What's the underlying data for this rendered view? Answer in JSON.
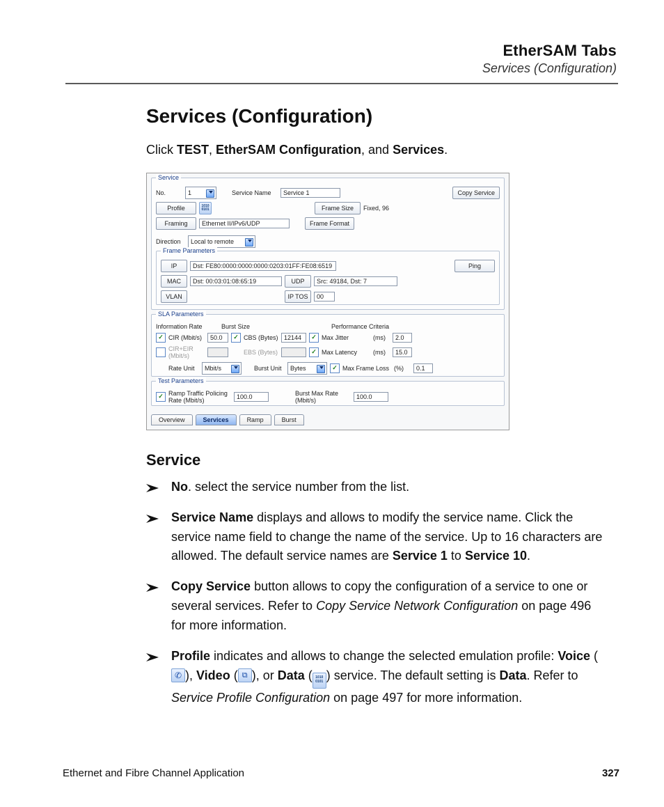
{
  "header": {
    "title": "EtherSAM Tabs",
    "subtitle": "Services (Configuration)"
  },
  "title": "Services (Configuration)",
  "intro": {
    "prefix": "Click ",
    "b1": "TEST",
    "mid1": ", ",
    "b2": "EtherSAM Configuration",
    "mid2": ", and ",
    "b3": "Services",
    "suffix": "."
  },
  "screenshot": {
    "service": {
      "legend": "Service",
      "no_label": "No.",
      "no_value": "1",
      "name_label": "Service Name",
      "name_value": "Service 1",
      "copy_btn": "Copy Service",
      "profile_btn": "Profile",
      "profile_icon_text": "1010\n0101",
      "framesize_btn": "Frame Size",
      "framesize_value": "Fixed, 96",
      "framing_btn": "Framing",
      "framing_value": "Ethernet II/IPv6/UDP",
      "frameformat_btn": "Frame Format",
      "direction_label": "Direction",
      "direction_value": "Local to remote"
    },
    "frame_params": {
      "legend": "Frame Parameters",
      "ip_btn": "IP",
      "ip_value": "Dst: FE80:0000:0000:0000:0203:01FF:FE08:6519",
      "ping_btn": "Ping",
      "mac_btn": "MAC",
      "mac_value": "Dst: 00:03:01:08:65:19",
      "udp_btn": "UDP",
      "udp_value": "Src: 49184, Dst: 7",
      "vlan_btn": "VLAN",
      "iptos_btn": "IP TOS",
      "iptos_value": "00"
    },
    "sla": {
      "legend": "SLA Parameters",
      "info_rate_header": "Information Rate",
      "burst_header": "Burst Size",
      "perf_header": "Performance Criteria",
      "cir_label": "CIR (Mbit/s)",
      "cir_value": "50.0",
      "cbs_label": "CBS (Bytes)",
      "cbs_value": "12144",
      "max_jitter_label": "Max Jitter",
      "ms": "(ms)",
      "max_jitter_value": "2.0",
      "cireir_label": "CIR+EIR (Mbit/s)",
      "ebs_label": "EBS (Bytes)",
      "max_latency_label": "Max Latency",
      "max_latency_value": "15.0",
      "rateunit_label": "Rate Unit",
      "rateunit_value": "Mbit/s",
      "burstunit_label": "Burst Unit",
      "burstunit_value": "Bytes",
      "max_frameloss_label": "Max Frame Loss",
      "pct": "(%)",
      "max_frameloss_value": "0.1"
    },
    "test": {
      "legend": "Test Parameters",
      "ramp_label": "Ramp Traffic Policing Rate (Mbit/s)",
      "ramp_value": "100.0",
      "burstmax_label": "Burst Max Rate (Mbit/s)",
      "burstmax_value": "100.0"
    },
    "tabs": {
      "overview": "Overview",
      "services": "Services",
      "ramp": "Ramp",
      "burst": "Burst"
    }
  },
  "section_heading": "Service",
  "bullets": {
    "b1_bold": "No",
    "b1_rest": ". select the service number from the list.",
    "b2_bold": "Service Name",
    "b2_rest1": " displays and allows to modify the service name. Click the service name field to change the name of the service. Up to 16 characters are allowed. The default service names are ",
    "b2_bold2": "Service 1",
    "b2_mid": " to ",
    "b2_bold3": "Service 10",
    "b2_end": ".",
    "b3_bold": "Copy Service",
    "b3_rest1": " button allows to copy the configuration of a service to one or several services. Refer to ",
    "b3_ital": "Copy Service Network Configuration",
    "b3_rest2": " on page 496 for more information.",
    "b4_bold": "Profile",
    "b4_rest1": " indicates and allows to change the selected emulation profile: ",
    "b4_voice": "Voice",
    "b4_p1": " (",
    "b4_p2": "), ",
    "b4_video": "Video",
    "b4_or": ", or ",
    "b4_data": "Data",
    "b4_p3": ") service. The default setting is ",
    "b4_data2": "Data",
    "b4_rest2": ". Refer to ",
    "b4_ital": "Service Profile Configuration",
    "b4_rest3": " on page 497 for more information."
  },
  "footer": {
    "book": "Ethernet and Fibre Channel Application",
    "page": "327"
  }
}
